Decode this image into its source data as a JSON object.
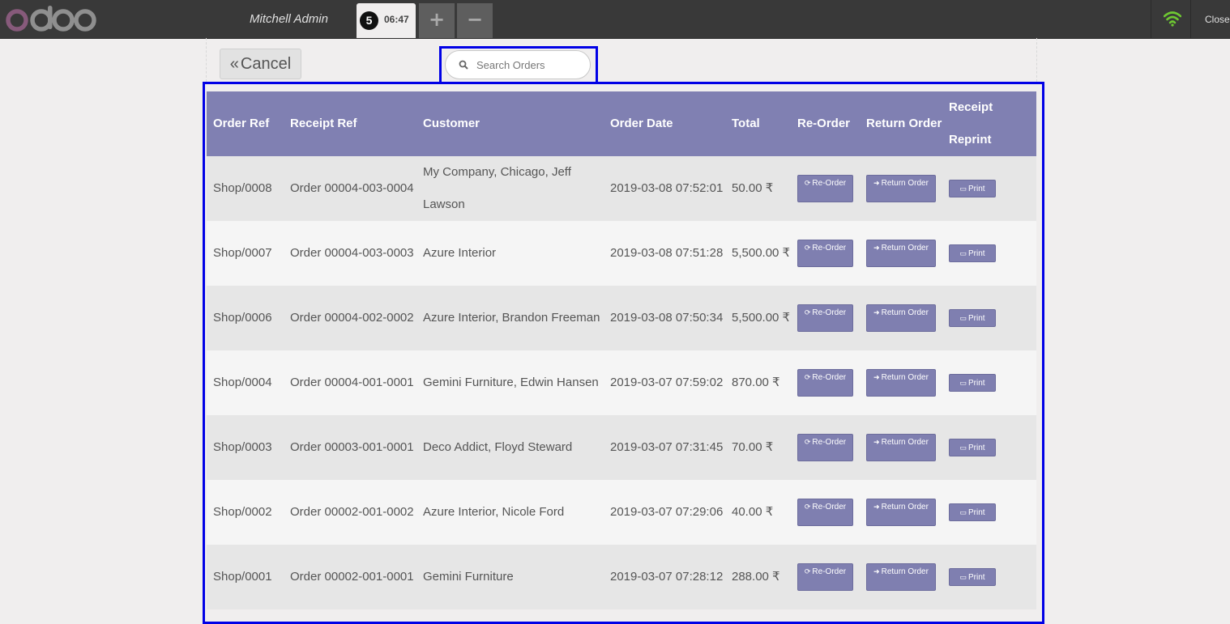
{
  "header": {
    "brand": "odoo",
    "user_name": "Mitchell Admin",
    "order_tab": {
      "number": "5",
      "time": "06:47"
    },
    "add_label": "+",
    "remove_label": "−",
    "close_label": "Close"
  },
  "toolbar": {
    "cancel_label": "Cancel",
    "search_placeholder": "Search Orders"
  },
  "table": {
    "columns": [
      "Order Ref",
      "Receipt Ref",
      "Customer",
      "Order Date",
      "Total",
      "Re-Order",
      "Return Order",
      "Receipt Reprint"
    ],
    "actions": {
      "reorder": "Re-Order",
      "return": "Return Order",
      "print": "Print"
    },
    "rows": [
      {
        "order_ref": "Shop/0008",
        "receipt_ref": "Order 00004-003-0004",
        "customer": "My Company, Chicago, Jeff Lawson",
        "date": "2019-03-08 07:52:01",
        "total": "50.00 ₹"
      },
      {
        "order_ref": "Shop/0007",
        "receipt_ref": "Order 00004-003-0003",
        "customer": "Azure Interior",
        "date": "2019-03-08 07:51:28",
        "total": "5,500.00 ₹"
      },
      {
        "order_ref": "Shop/0006",
        "receipt_ref": "Order 00004-002-0002",
        "customer": "Azure Interior, Brandon Freeman",
        "date": "2019-03-08 07:50:34",
        "total": "5,500.00 ₹"
      },
      {
        "order_ref": "Shop/0004",
        "receipt_ref": "Order 00004-001-0001",
        "customer": "Gemini Furniture, Edwin Hansen",
        "date": "2019-03-07 07:59:02",
        "total": "870.00 ₹"
      },
      {
        "order_ref": "Shop/0003",
        "receipt_ref": "Order 00003-001-0001",
        "customer": "Deco Addict, Floyd Steward",
        "date": "2019-03-07 07:31:45",
        "total": "70.00 ₹"
      },
      {
        "order_ref": "Shop/0002",
        "receipt_ref": "Order 00002-001-0002",
        "customer": "Azure Interior, Nicole Ford",
        "date": "2019-03-07 07:29:06",
        "total": "40.00 ₹"
      },
      {
        "order_ref": "Shop/0001",
        "receipt_ref": "Order 00002-001-0001",
        "customer": "Gemini Furniture",
        "date": "2019-03-07 07:28:12",
        "total": "288.00 ₹"
      }
    ]
  },
  "colors": {
    "topbar": "#393939",
    "header_row": "#8080b2",
    "action_button": "#7f7fb0",
    "highlight": "#0000e6",
    "brand_o": "#875a7b",
    "brand_doo": "#8f8f8f",
    "wifi": "#6ec832"
  },
  "icons": {
    "reorder": "refresh-icon",
    "return": "sign-in-icon",
    "print": "printer-icon",
    "search": "search-icon",
    "status": "wifi-icon"
  }
}
